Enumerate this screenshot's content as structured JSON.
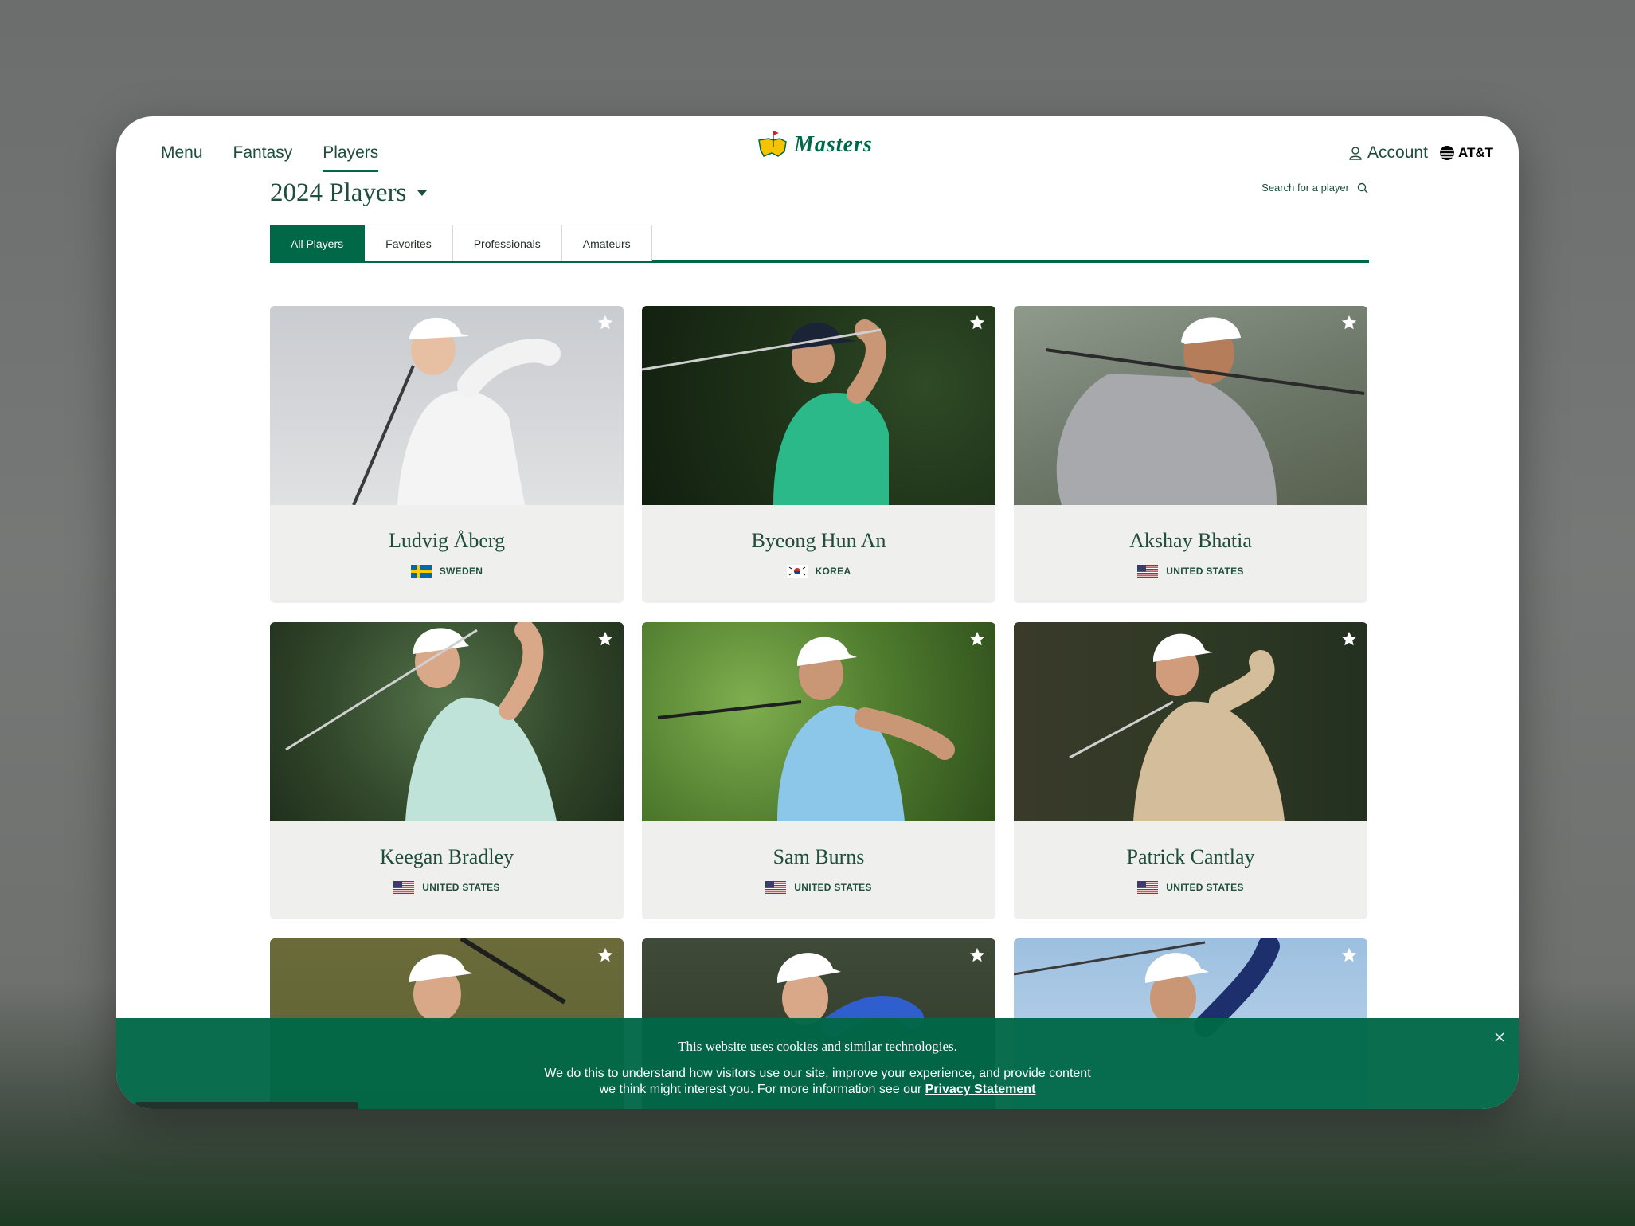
{
  "nav": {
    "menu": "Menu",
    "fantasy": "Fantasy",
    "players": "Players",
    "logo": "Masters",
    "account": "Account",
    "sponsor": "AT&T"
  },
  "header": {
    "title": "2024 Players",
    "search_label": "Search for a player"
  },
  "tabs": [
    "All Players",
    "Favorites",
    "Professionals",
    "Amateurs"
  ],
  "players": [
    {
      "name": "Ludvig Åberg",
      "country": "SWEDEN",
      "flag": "sweden-flag-icon"
    },
    {
      "name": "Byeong Hun An",
      "country": "KOREA",
      "flag": "korea-flag-icon"
    },
    {
      "name": "Akshay Bhatia",
      "country": "UNITED STATES",
      "flag": "us-flag-icon"
    },
    {
      "name": "Keegan Bradley",
      "country": "UNITED STATES",
      "flag": "us-flag-icon"
    },
    {
      "name": "Sam Burns",
      "country": "UNITED STATES",
      "flag": "us-flag-icon"
    },
    {
      "name": "Patrick Cantlay",
      "country": "UNITED STATES",
      "flag": "us-flag-icon"
    }
  ],
  "cookie": {
    "title": "This website uses cookies and similar technologies.",
    "line1": "We do this to understand how visitors use our site, improve your experience, and provide content",
    "line2": "we think might interest you. For more information see our",
    "link": "Privacy Statement"
  },
  "colors": {
    "brand_green": "#006747",
    "text_green": "#1f4e3d",
    "card_bg": "#efefed"
  }
}
